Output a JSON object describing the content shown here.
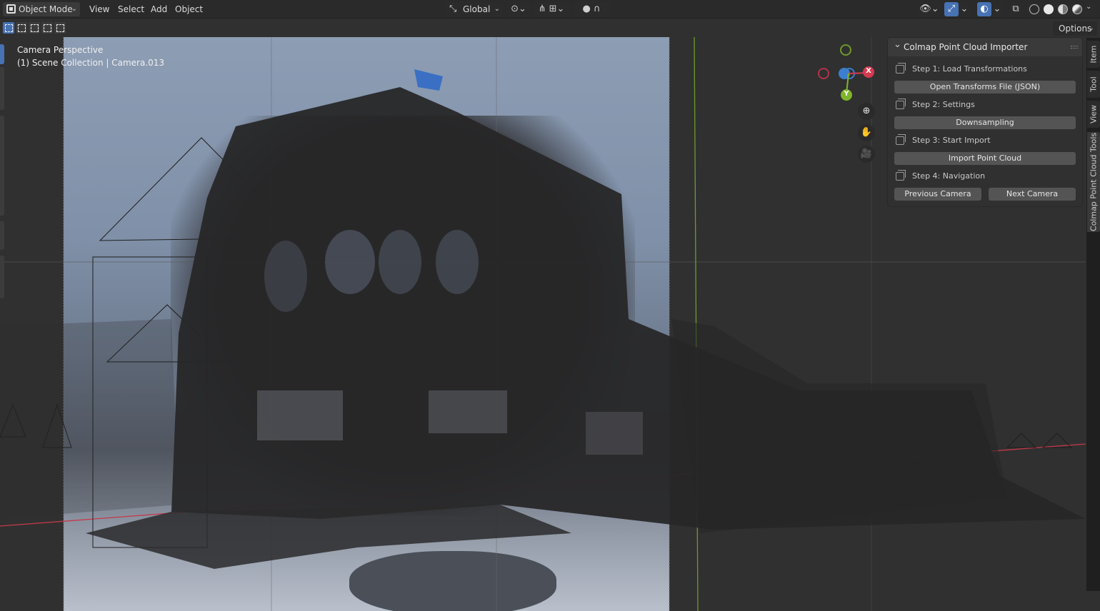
{
  "header": {
    "mode": "Object Mode",
    "menus": [
      "View",
      "Select",
      "Add",
      "Object"
    ],
    "transform_orientation": "Global",
    "options_label": "Options"
  },
  "viewport": {
    "perspective_label": "Camera Perspective",
    "collection_label": "(1) Scene Collection | Camera.013",
    "gizmo": {
      "x_label": "X",
      "y_label": "Y"
    },
    "colors": {
      "x_axis": "#d43a50",
      "y_axis": "#7fb52a",
      "z_axis": "#3b7fd1",
      "point_cloud": "#272728"
    }
  },
  "panel": {
    "title": "Colmap Point Cloud Importer",
    "step1_label": "Step 1: Load Transformations",
    "step1_button": "Open Transforms File (JSON)",
    "step2_label": "Step 2: Settings",
    "step2_button": "Downsampling",
    "step3_label": "Step 3: Start Import",
    "step3_button": "Import Point Cloud",
    "step4_label": "Step 4: Navigation",
    "prev_button": "Previous Camera",
    "next_button": "Next Camera"
  },
  "tabs": [
    "Item",
    "Tool",
    "View",
    "Colmap Point Cloud Tools"
  ]
}
